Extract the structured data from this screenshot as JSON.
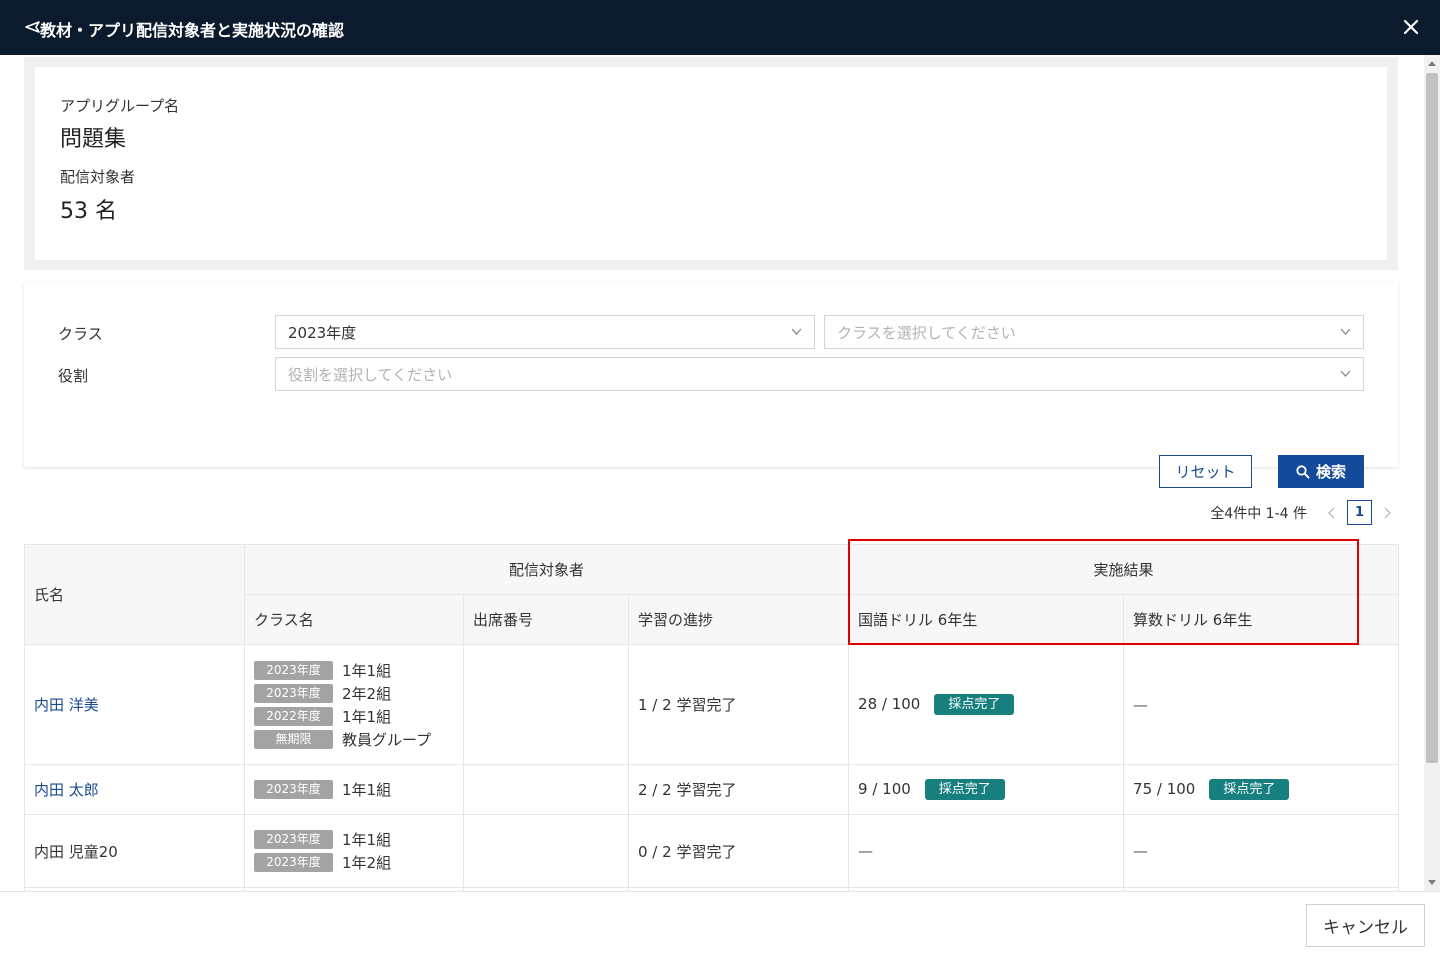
{
  "header": {
    "title": "教材・アプリ配信対象者と実施状況の確認",
    "back_icon": "back-arrow-icon",
    "close_icon": "close-icon"
  },
  "info": {
    "group_label": "アプリグループ名",
    "group_value": "問題集",
    "target_label": "配信対象者",
    "target_value": "53 名"
  },
  "filter": {
    "class_label": "クラス",
    "role_label": "役割",
    "year_value": "2023年度",
    "class_placeholder": "クラスを選択してください",
    "role_placeholder": "役割を選択してください",
    "reset_label": "リセット",
    "search_label": "検索"
  },
  "pager": {
    "count_text": "全4件中 1-4 件",
    "current_page": "1"
  },
  "table": {
    "col_name": "氏名",
    "group_target": "配信対象者",
    "group_result": "実施結果",
    "col_class": "クラス名",
    "col_seat": "出席番号",
    "col_progress": "学習の進捗",
    "col_drill1": "国語ドリル 6年生",
    "col_drill2": "算数ドリル 6年生",
    "rows": [
      {
        "name": "内田 洋美",
        "classes": [
          {
            "tag": "2023年度",
            "cls": "1年1組"
          },
          {
            "tag": "2023年度",
            "cls": "2年2組"
          },
          {
            "tag": "2022年度",
            "cls": "1年1組"
          },
          {
            "tag": "無期限",
            "cls": "教員グループ"
          }
        ],
        "seat": "",
        "progress": "1 / 2 学習完了",
        "drill1_score": "28 / 100",
        "drill1_badge": "採点完了",
        "drill2_score": "—",
        "drill2_badge": ""
      },
      {
        "name": "内田 太郎",
        "classes": [
          {
            "tag": "2023年度",
            "cls": "1年1組"
          }
        ],
        "seat": "",
        "progress": "2 / 2 学習完了",
        "drill1_score": "9 / 100",
        "drill1_badge": "採点完了",
        "drill2_score": "75 / 100",
        "drill2_badge": "採点完了"
      },
      {
        "name": "内田 児童20",
        "classes": [
          {
            "tag": "2023年度",
            "cls": "1年1組"
          },
          {
            "tag": "2023年度",
            "cls": "1年2組"
          }
        ],
        "seat": "",
        "progress": "0 / 2 学習完了",
        "drill1_score": "—",
        "drill1_badge": "",
        "drill2_score": "—",
        "drill2_badge": ""
      }
    ]
  },
  "footer": {
    "cancel_label": "キャンセル"
  },
  "colors": {
    "header_bg": "#0b1a2c",
    "primary": "#134a99",
    "badge": "#17807e",
    "tag": "#a3a3a3",
    "highlight": "#e00000"
  }
}
